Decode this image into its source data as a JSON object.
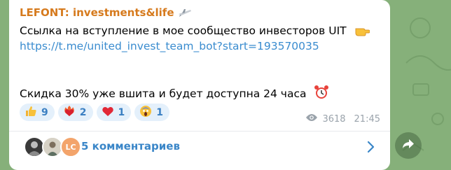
{
  "message": {
    "sender": "LEFONT: investments&life",
    "line1": "Ссылка на вступление в мое сообщество инвесторов UIT",
    "link": "https://t.me/united_invest_team_bot?start=193570035",
    "line3": "Скидка 30% уже вшита и будет доступна 24 часа"
  },
  "reactions": [
    {
      "emoji": "👍",
      "count": "9"
    },
    {
      "emoji": "❤️‍🔥",
      "count": "2"
    },
    {
      "emoji": "❤️",
      "count": "1"
    },
    {
      "emoji": "😱",
      "count": "1"
    }
  ],
  "meta": {
    "views": "3618",
    "time": "21:45"
  },
  "comments": {
    "label": "5 комментариев",
    "avatar3_initials": "LC"
  },
  "colors": {
    "background": "#86b07a",
    "sender": "#d67a1d",
    "link": "#3a8ccf",
    "reaction_bg": "#e4f0fb"
  }
}
